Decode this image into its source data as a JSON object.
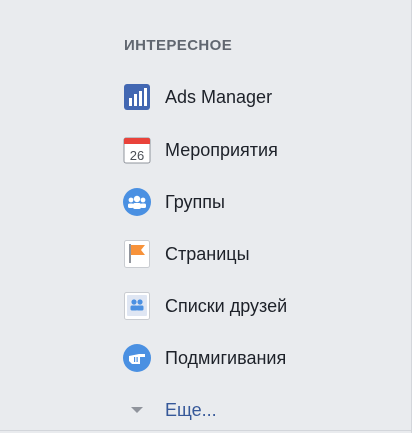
{
  "section": {
    "title": "ИНТЕРЕСНОЕ"
  },
  "items": [
    {
      "label": "Ads Manager",
      "icon": "ads-manager-icon"
    },
    {
      "label": "Мероприятия",
      "icon": "calendar-icon",
      "icon_text": "26"
    },
    {
      "label": "Группы",
      "icon": "groups-icon"
    },
    {
      "label": "Страницы",
      "icon": "flag-icon"
    },
    {
      "label": "Списки друзей",
      "icon": "friend-lists-icon"
    },
    {
      "label": "Подмигивания",
      "icon": "poke-icon"
    }
  ],
  "more": {
    "label": "Еще...",
    "icon": "caret-down-icon"
  },
  "colors": {
    "background": "#e9ebee",
    "section_title": "#616770",
    "item_text": "#1d2129",
    "link_text": "#365899",
    "ads_blue": "#4267b2",
    "groups_blue": "#4a90e2",
    "calendar_red": "#e9423a",
    "flag_orange": "#f7923a"
  }
}
